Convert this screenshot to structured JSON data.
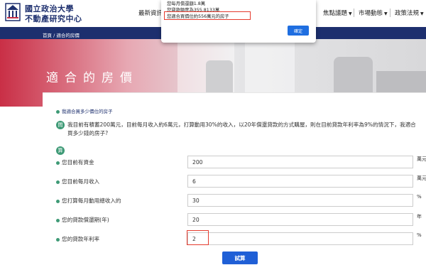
{
  "logo": {
    "line1": "國立政治大學",
    "line2": "不動產研究中心"
  },
  "nav": {
    "items": [
      "最新資訊",
      "焦點議題",
      "市場動態",
      "政策法規"
    ]
  },
  "breadcrumb": {
    "home": "首頁",
    "sep": "/",
    "current": "適合的房價"
  },
  "banner": {
    "title": "適合的房價"
  },
  "section": {
    "title": "我適合買多少價位的房子"
  },
  "question": {
    "badge": "問",
    "text": "我目前有積蓄200萬元，目前每月收入約6萬元，打算動用30%的收入，以20年償還貸款的方式購屋，則在目前貸款年利率為9%的情況下，我適合買多少錢的房子?"
  },
  "answer": {
    "badge": "算"
  },
  "form": {
    "rows": [
      {
        "label": "您目前有資金",
        "value": "200",
        "unit": "萬元"
      },
      {
        "label": "您目前每月收入",
        "value": "6",
        "unit": "萬元"
      },
      {
        "label": "您打算每月動用總收入的",
        "value": "30",
        "unit": "%"
      },
      {
        "label": "您的貸款償還期(年)",
        "value": "20",
        "unit": "年"
      },
      {
        "label": "您的貸款年利率",
        "value": "2",
        "unit": "%"
      }
    ],
    "calc_label": "試算"
  },
  "alert": {
    "line1": "您每月償還額1.8萬",
    "line2": "您貸款額度為355.8133萬",
    "line3": "您適合買價位約556萬元的房子",
    "ok_label": "確定"
  },
  "colors": {
    "navy": "#1d2f6e",
    "green": "#3e9a76",
    "blue_button": "#1f5fd6",
    "highlight_red": "#e53b2e"
  }
}
